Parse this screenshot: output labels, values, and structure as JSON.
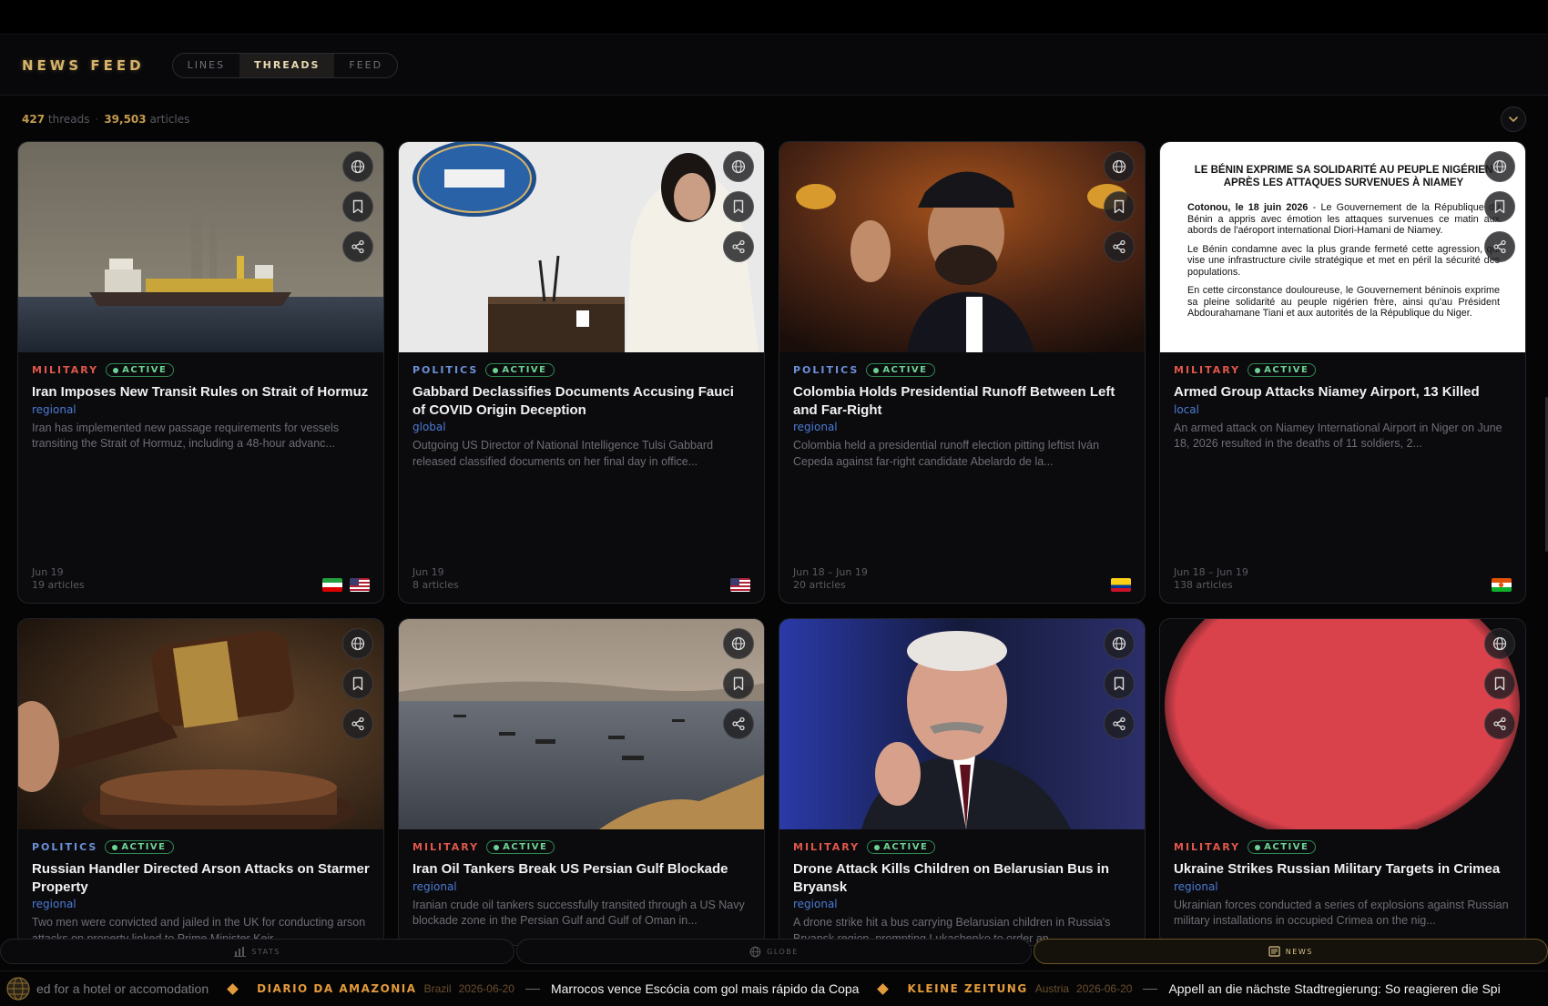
{
  "app": {
    "logo": "NEWS FEED"
  },
  "view_tabs": [
    "LINES",
    "THREADS",
    "FEED"
  ],
  "active_tab": "THREADS",
  "counts": {
    "threads": "427",
    "threads_label": "threads",
    "articles": "39,503",
    "articles_label": "articles",
    "separator": "·"
  },
  "cards": [
    {
      "category": "MILITARY",
      "status": "ACTIVE",
      "title": "Iran Imposes New Transit Rules on Strait of Hormuz",
      "scope": "regional",
      "summary": "Iran has implemented new passage requirements for vessels transiting the Strait of Hormuz, including a 48-hour advanc...",
      "dates": "Jun 19",
      "articles": "19 articles",
      "flags": [
        "iran",
        "usa"
      ],
      "image": "cargo-ship"
    },
    {
      "category": "POLITICS",
      "status": "ACTIVE",
      "title": "Gabbard Declassifies Documents Accusing Fauci of COVID Origin Deception",
      "scope": "global",
      "summary": "Outgoing US Director of National Intelligence Tulsi Gabbard released classified documents on her final day in office...",
      "dates": "Jun 19",
      "articles": "8 articles",
      "flags": [
        "usa"
      ],
      "image": "white-house-podium"
    },
    {
      "category": "POLITICS",
      "status": "ACTIVE",
      "title": "Colombia Holds Presidential Runoff Between Left and Far-Right",
      "scope": "regional",
      "summary": "Colombia held a presidential runoff election pitting leftist Iván Cepeda against far-right candidate Abelardo de la...",
      "dates": "Jun 18 – Jun 19",
      "articles": "20 articles",
      "flags": [
        "colombia"
      ],
      "image": "candidate-speaking"
    },
    {
      "category": "MILITARY",
      "status": "ACTIVE",
      "title": "Armed Group Attacks Niamey Airport, 13 Killed",
      "scope": "local",
      "summary": "An armed attack on Niamey International Airport in Niger on June 18, 2026 resulted in the deaths of 11 soldiers, 2...",
      "dates": "Jun 18 – Jun 19",
      "articles": "138 articles",
      "flags": [
        "niger"
      ],
      "image": "press-release",
      "press_release": {
        "heading": "LE BÉNIN EXPRIME SA SOLIDARITÉ AU PEUPLE NIGÉRIEN APRÈS LES ATTAQUES SURVENUES À NIAMEY",
        "dateline": "Cotonou, le 18 juin 2026",
        "p1": " - Le Gouvernement de la République du Bénin a appris avec émotion les attaques survenues ce matin aux abords de l'aéroport international Diori-Hamani de Niamey.",
        "p2": "Le Bénin condamne avec la plus grande fermeté cette agression, qui vise une infrastructure civile stratégique et met en péril la sécurité des populations.",
        "p3": "En cette circonstance douloureuse, le Gouvernement béninois exprime sa pleine solidarité au peuple nigérien frère, ainsi qu'au Président Abdourahamane Tiani et aux autorités de la République du Niger."
      }
    },
    {
      "category": "POLITICS",
      "status": "ACTIVE",
      "title": "Russian Handler Directed Arson Attacks on Starmer Property",
      "scope": "regional",
      "summary": "Two men were convicted and jailed in the UK for conducting arson attacks on property linked to Prime Minister Keir...",
      "image": "gavel"
    },
    {
      "category": "MILITARY",
      "status": "ACTIVE",
      "title": "Iran Oil Tankers Break US Persian Gulf Blockade",
      "scope": "regional",
      "summary": "Iranian crude oil tankers successfully transited through a US Navy blockade zone in the Persian Gulf and Gulf of Oman in...",
      "image": "gulf-tankers"
    },
    {
      "category": "MILITARY",
      "status": "ACTIVE",
      "title": "Drone Attack Kills Children on Belarusian Bus in Bryansk",
      "scope": "regional",
      "summary": "A drone strike hit a bus carrying Belarusian children in Russia's Bryansk region, prompting Lukashenko to order an...",
      "image": "leader-speaking"
    },
    {
      "category": "MILITARY",
      "status": "ACTIVE",
      "title": "Ukraine Strikes Russian Military Targets in Crimea",
      "scope": "regional",
      "summary": "Ukrainian forces conducted a series of explosions against Russian military installations in occupied Crimea on the nig...",
      "image": "red-placeholder"
    }
  ],
  "bottom_nav": [
    {
      "label": "STATS",
      "icon": "bar-chart-icon"
    },
    {
      "label": "GLOBE",
      "icon": "globe-icon"
    },
    {
      "label": "NEWS",
      "icon": "newspaper-icon"
    }
  ],
  "active_bottom": "NEWS",
  "ticker": {
    "lead": "ed for a hotel or accomodation",
    "items": [
      {
        "source": "DIARIO DA AMAZONIA",
        "country": "Brazil",
        "date": "2026-06-20",
        "headline": "Marrocos vence Escócia com gol mais rápido da Copa"
      },
      {
        "source": "KLEINE ZEITUNG",
        "country": "Austria",
        "date": "2026-06-20",
        "headline": "Appell an die nächste Stadtregierung: So reagieren die Spi"
      }
    ]
  },
  "colors": {
    "accent": "#d7b46a",
    "military": "#e0574a",
    "politics": "#6c8fd8",
    "active": "#6dd394",
    "ticker_source": "#e39a3a"
  }
}
